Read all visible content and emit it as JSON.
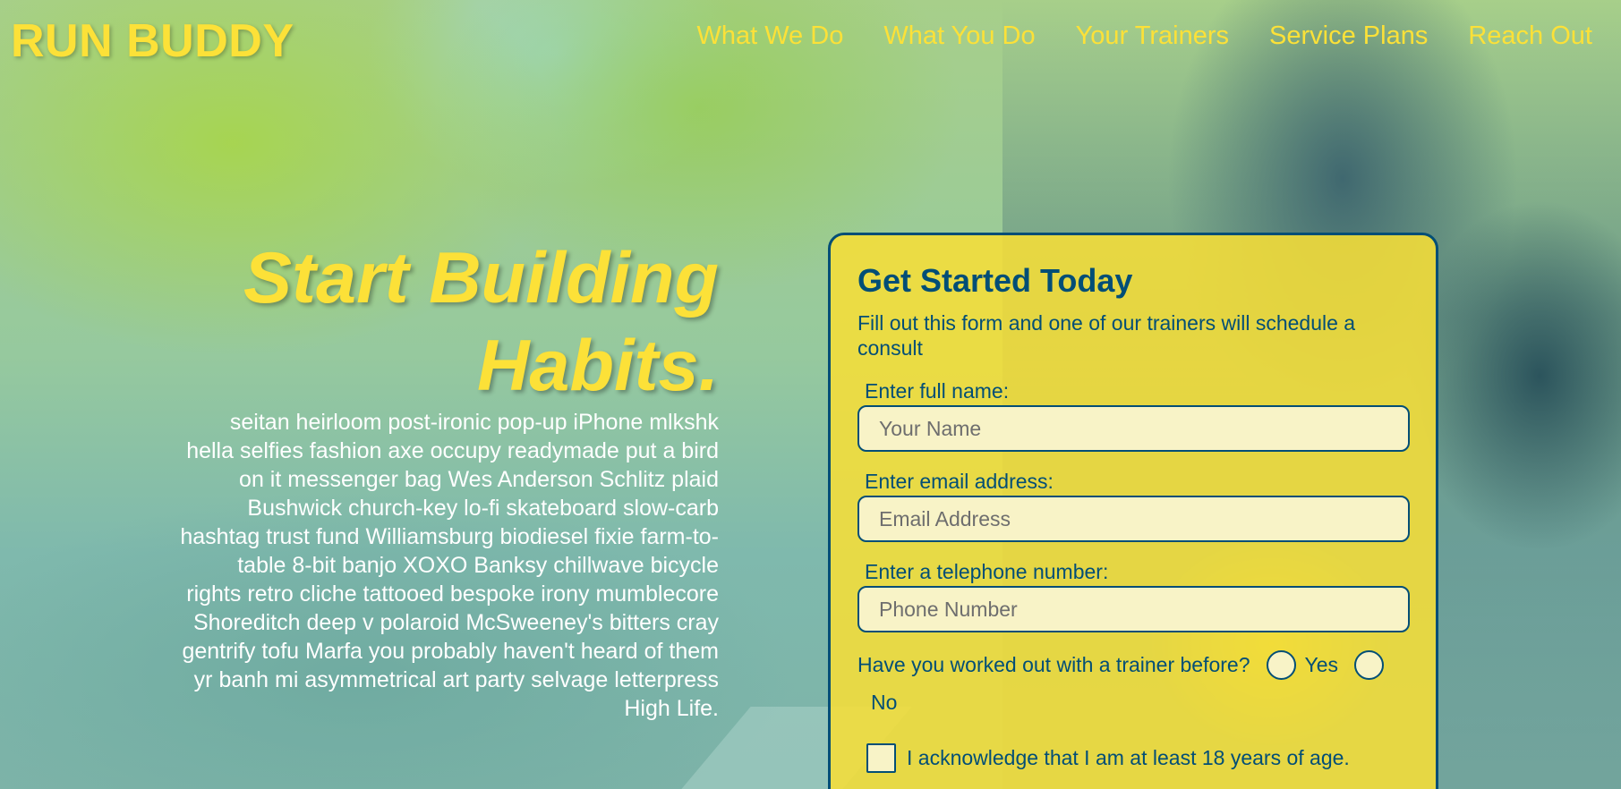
{
  "brand": "RUN BUDDY",
  "nav": {
    "items": [
      {
        "label": "What We Do"
      },
      {
        "label": "What You Do"
      },
      {
        "label": "Your Trainers"
      },
      {
        "label": "Service Plans"
      },
      {
        "label": "Reach Out"
      }
    ]
  },
  "hero": {
    "title_line1": "Start Building",
    "title_line2": "Habits.",
    "text": "seitan heirloom post-ironic pop-up iPhone mlkshk hella selfies fashion axe occupy readymade put a bird on it messenger bag Wes Anderson Schlitz plaid Bushwick church-key lo-fi skateboard slow-carb hashtag trust fund Williamsburg biodiesel fixie farm-to-table 8-bit banjo XOXO Banksy chillwave bicycle rights retro cliche tattooed bespoke irony mumblecore Shoreditch deep v polaroid McSweeney's bitters cray gentrify tofu Marfa you probably haven't heard of them yr banh mi asymmetrical art party selvage letterpress High Life."
  },
  "form": {
    "title": "Get Started Today",
    "subtitle": "Fill out this form and one of our trainers will schedule a consult",
    "name_label": "Enter full name:",
    "name_placeholder": "Your Name",
    "name_value": "",
    "email_label": "Enter email address:",
    "email_placeholder": "Email Address",
    "email_value": "",
    "phone_label": "Enter a telephone number:",
    "phone_placeholder": "Phone Number",
    "phone_value": "",
    "trainer_question": "Have you worked out with a trainer before?",
    "yes_label": "Yes",
    "no_label": "No",
    "ack_label": "I acknowledge that I am at least 18 years of age."
  },
  "colors": {
    "accent_yellow": "#fce138",
    "brand_blue": "#024e76"
  }
}
